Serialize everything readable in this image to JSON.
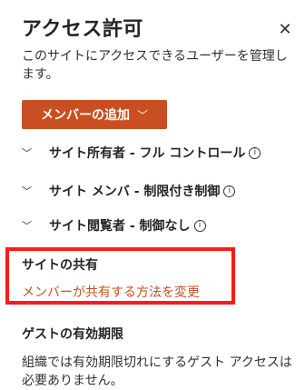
{
  "panel": {
    "title": "アクセス許可",
    "close_glyph": "✕",
    "description": "このサイトにアクセスできるユーザーを管理します。",
    "add_member_label": "メンバーの追加",
    "add_member_chevron": "﹀"
  },
  "permissions": [
    {
      "label": "サイト所有者 - フル コントロール",
      "chevron": "﹀",
      "info": "i"
    },
    {
      "label": "サイト メンバ - 制限付き制御",
      "chevron": "﹀",
      "info": "i"
    },
    {
      "label": "サイト閲覧者 - 制御なし",
      "chevron": "﹀",
      "info": "i"
    }
  ],
  "site_sharing": {
    "title": "サイトの共有",
    "change_link": "メンバーが共有する方法を変更"
  },
  "guest_expiration": {
    "title": "ゲストの有効期限",
    "description": "組織では有効期限切れにするゲスト アクセスは必要ありません。"
  },
  "colors": {
    "accent": "#c94f22",
    "highlight_box": "#ff1a1a"
  }
}
